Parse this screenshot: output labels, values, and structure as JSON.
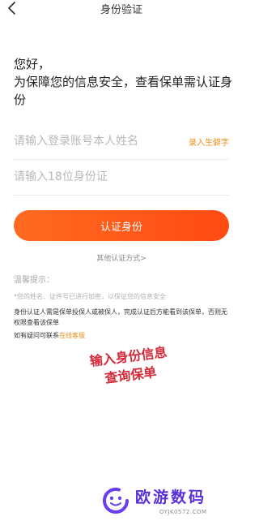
{
  "header": {
    "title": "身份验证",
    "back_icon": "chevron-left-icon"
  },
  "greeting": {
    "line1": "您好，",
    "line2": "为保障您的信息安全，查看保单需认证身份"
  },
  "form": {
    "name_placeholder": "请输入登录账号本人姓名",
    "rare_char_label": "录入生僻字",
    "id_placeholder": "请输入18位身份证"
  },
  "verify_button_label": "认证身份",
  "other_methods_label": "其他认证方式>",
  "tips": {
    "title": "温馨提示：",
    "encrypted": "*您的姓名、证件号已进行加密，以保证您的信息安全",
    "requirement": "身份认证人需是保单投保人或被保人，完成认证后方能看到该保单，否则无权限查看该保单",
    "contact_prefix": "如有疑问可联系",
    "contact_link": "在线客服"
  },
  "overlay": {
    "line1": "输入身份信息",
    "line2": "查询保单"
  },
  "watermark": {
    "name": "欧游数码",
    "url": "OYJK0572.COM",
    "logo_icon": "ring-logo-icon"
  },
  "colors": {
    "accent": "#ff5a1a",
    "link": "#e8901c",
    "overlay_text": "#d62a3a",
    "watermark": "#5a30d8"
  }
}
